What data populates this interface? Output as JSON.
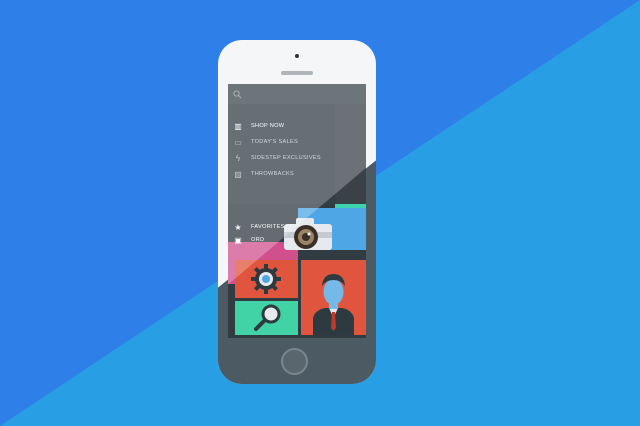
{
  "colors": {
    "bg_left": "#2f7fe8",
    "bg_right": "#289ee4",
    "phone_white": "#f4f6f8",
    "phone_dark": "#4c5a63",
    "screen": "#303b42"
  },
  "menu": {
    "items": [
      {
        "label": "SHOP NOW",
        "icon": "store-icon",
        "active": true
      },
      {
        "label": "TODAY'S SALES",
        "icon": "tag-icon",
        "active": false
      },
      {
        "label": "SIDESTEP EXCLUSIVES",
        "icon": "bolt-icon",
        "active": false
      },
      {
        "label": "THROWBACKS",
        "icon": "image-icon",
        "active": false
      }
    ]
  },
  "lower_menu": {
    "items": [
      {
        "label": "FAVORITES",
        "icon": "star-icon"
      },
      {
        "label": "ORD",
        "icon": "bag-icon"
      }
    ]
  },
  "tiles": [
    "camera",
    "settings",
    "search",
    "profile"
  ]
}
